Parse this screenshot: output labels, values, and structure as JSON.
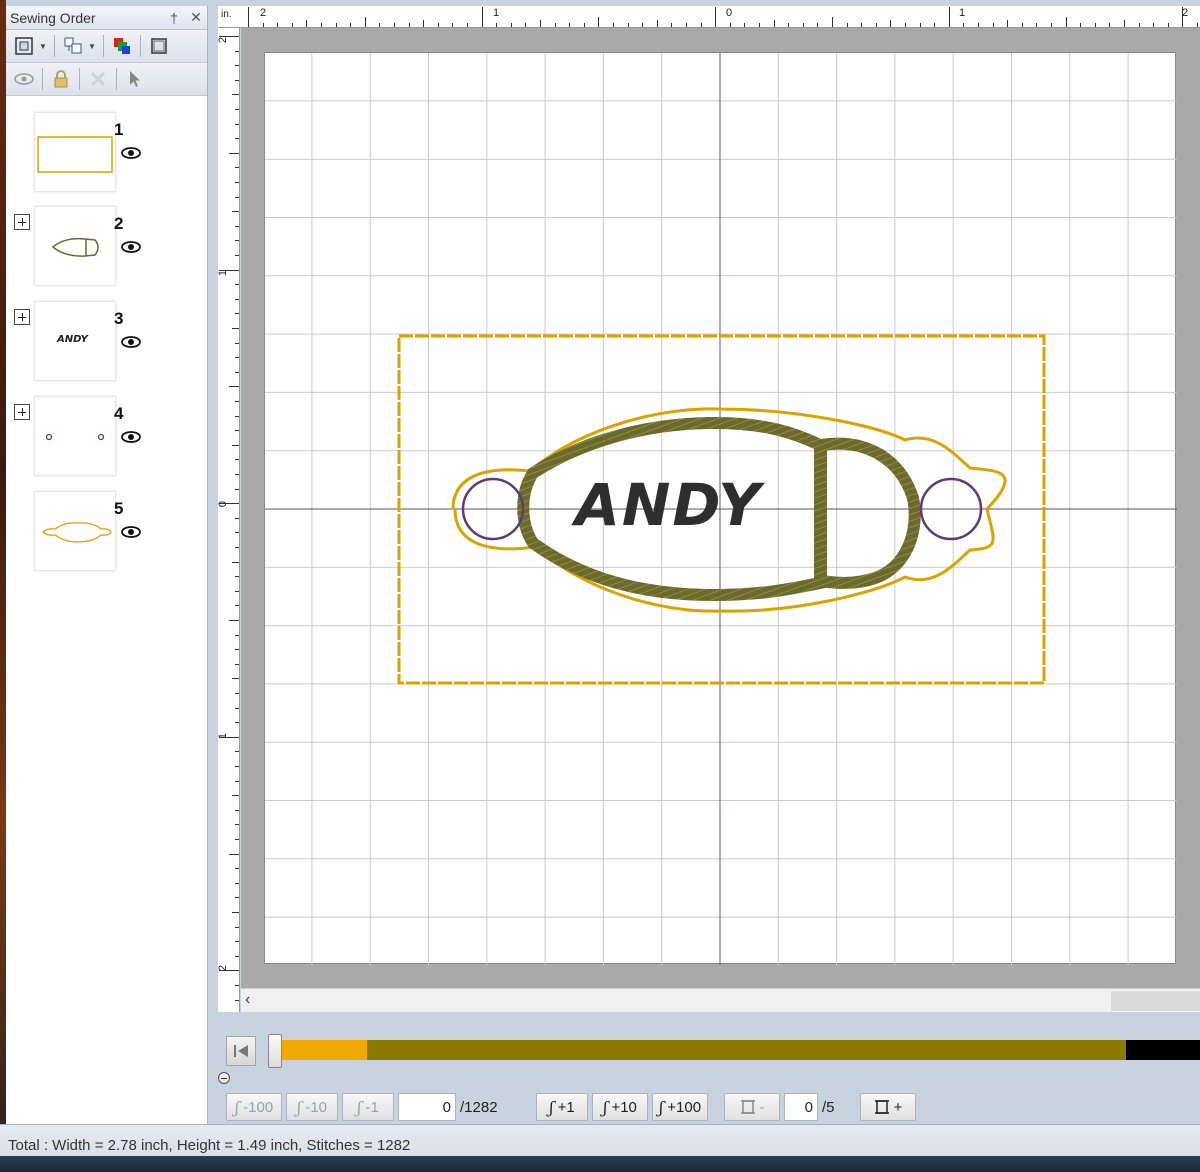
{
  "panel": {
    "title": "Sewing Order",
    "pin_glyph": "†",
    "close_glyph": "✕"
  },
  "sewing_items": [
    {
      "number": "1",
      "expandable": false
    },
    {
      "number": "2",
      "expandable": true
    },
    {
      "number": "3",
      "expandable": true,
      "thumb_text": "ANDY"
    },
    {
      "number": "4",
      "expandable": true
    },
    {
      "number": "5",
      "expandable": false
    }
  ],
  "ruler": {
    "unit": "in.",
    "top_labels": [
      "2",
      "1",
      "0",
      "1",
      "2"
    ],
    "left_labels": [
      "2",
      "1",
      "0",
      "1",
      "2"
    ]
  },
  "design": {
    "text": "ANDY"
  },
  "colors": {
    "frame": "#d9a300",
    "olive": "#6b6a2a",
    "circle": "#5b3c79",
    "text": "#2e2e2e",
    "slider_seg1": "#f0aa00",
    "slider_seg2": "#8a7a00",
    "slider_seg3": "#000000"
  },
  "slider": {
    "segments": [
      0.1,
      0.82,
      0.08
    ]
  },
  "steps": {
    "back100": "-100",
    "back10": "-10",
    "back1": "-1",
    "current_stitch": "0",
    "total_stitch": "/1282",
    "fwd1": "+1",
    "fwd10": "+10",
    "fwd100": "+100",
    "color_minus": "-",
    "current_color": "0",
    "total_color": "/5",
    "color_plus": "+"
  },
  "status": {
    "text": "Total : Width = 2.78 inch, Height = 1.49 inch, Stitches = 1282"
  }
}
